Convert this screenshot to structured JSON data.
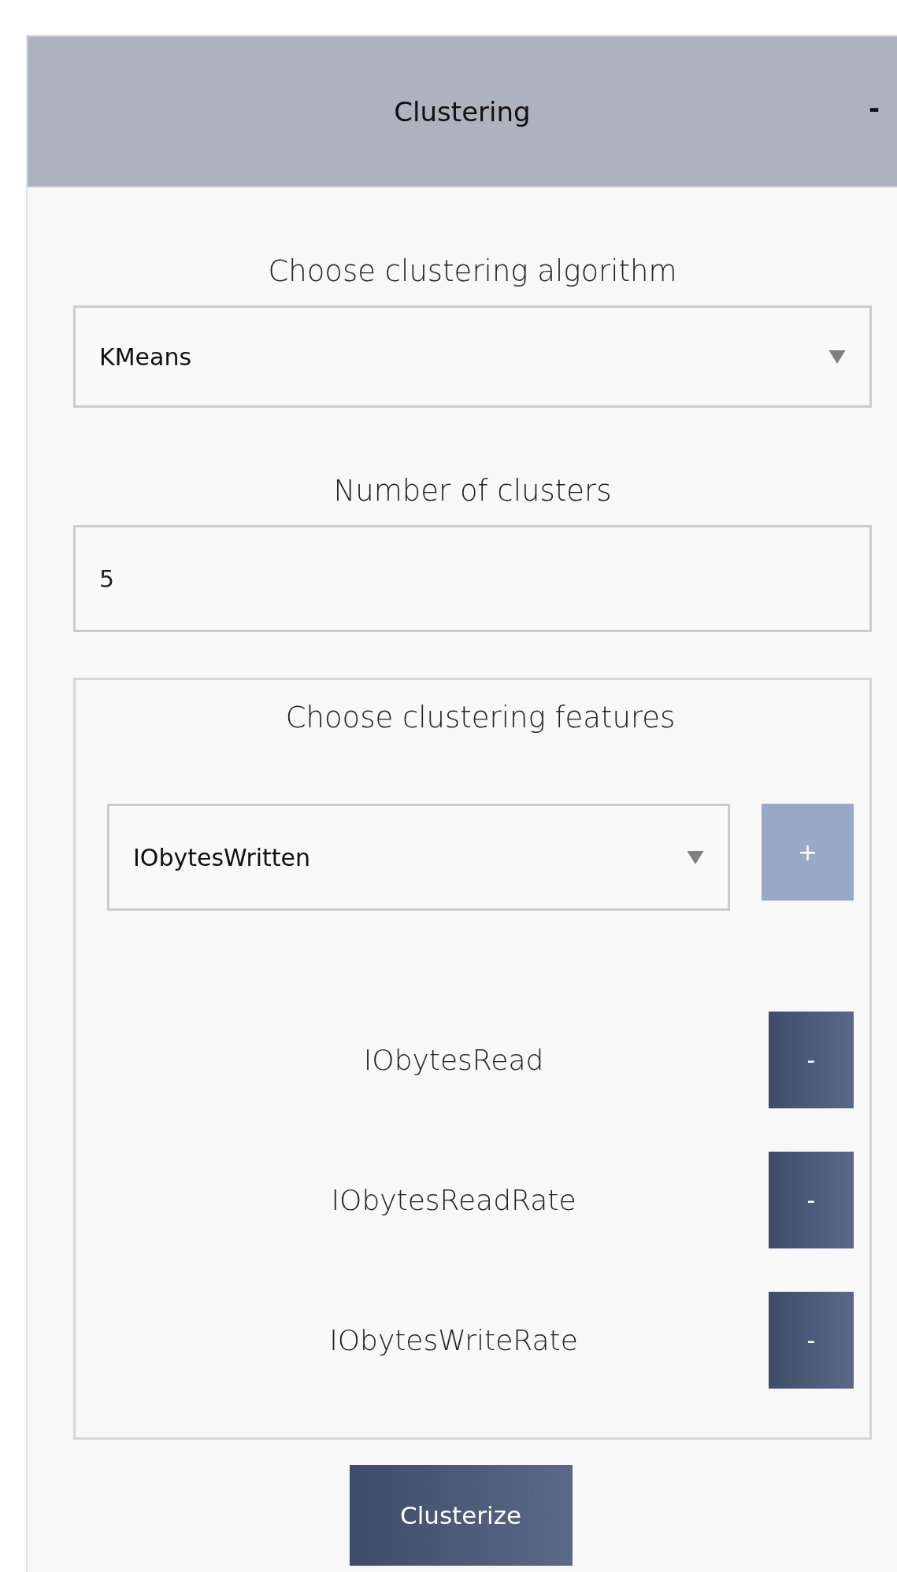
{
  "panel": {
    "title": "Clustering",
    "toggle": "-"
  },
  "algorithm": {
    "label": "Choose clustering algorithm",
    "value": "KMeans"
  },
  "clusters": {
    "label": "Number of clusters",
    "value": "5"
  },
  "features": {
    "label": "Choose clustering features",
    "select_value": "IObytesWritten",
    "add_button": "+",
    "items": [
      {
        "name": "IObytesRead",
        "remove_button": "-"
      },
      {
        "name": "IObytesReadRate",
        "remove_button": "-"
      },
      {
        "name": "IObytesWriteRate",
        "remove_button": "-"
      }
    ]
  },
  "submit_button": "Clusterize"
}
